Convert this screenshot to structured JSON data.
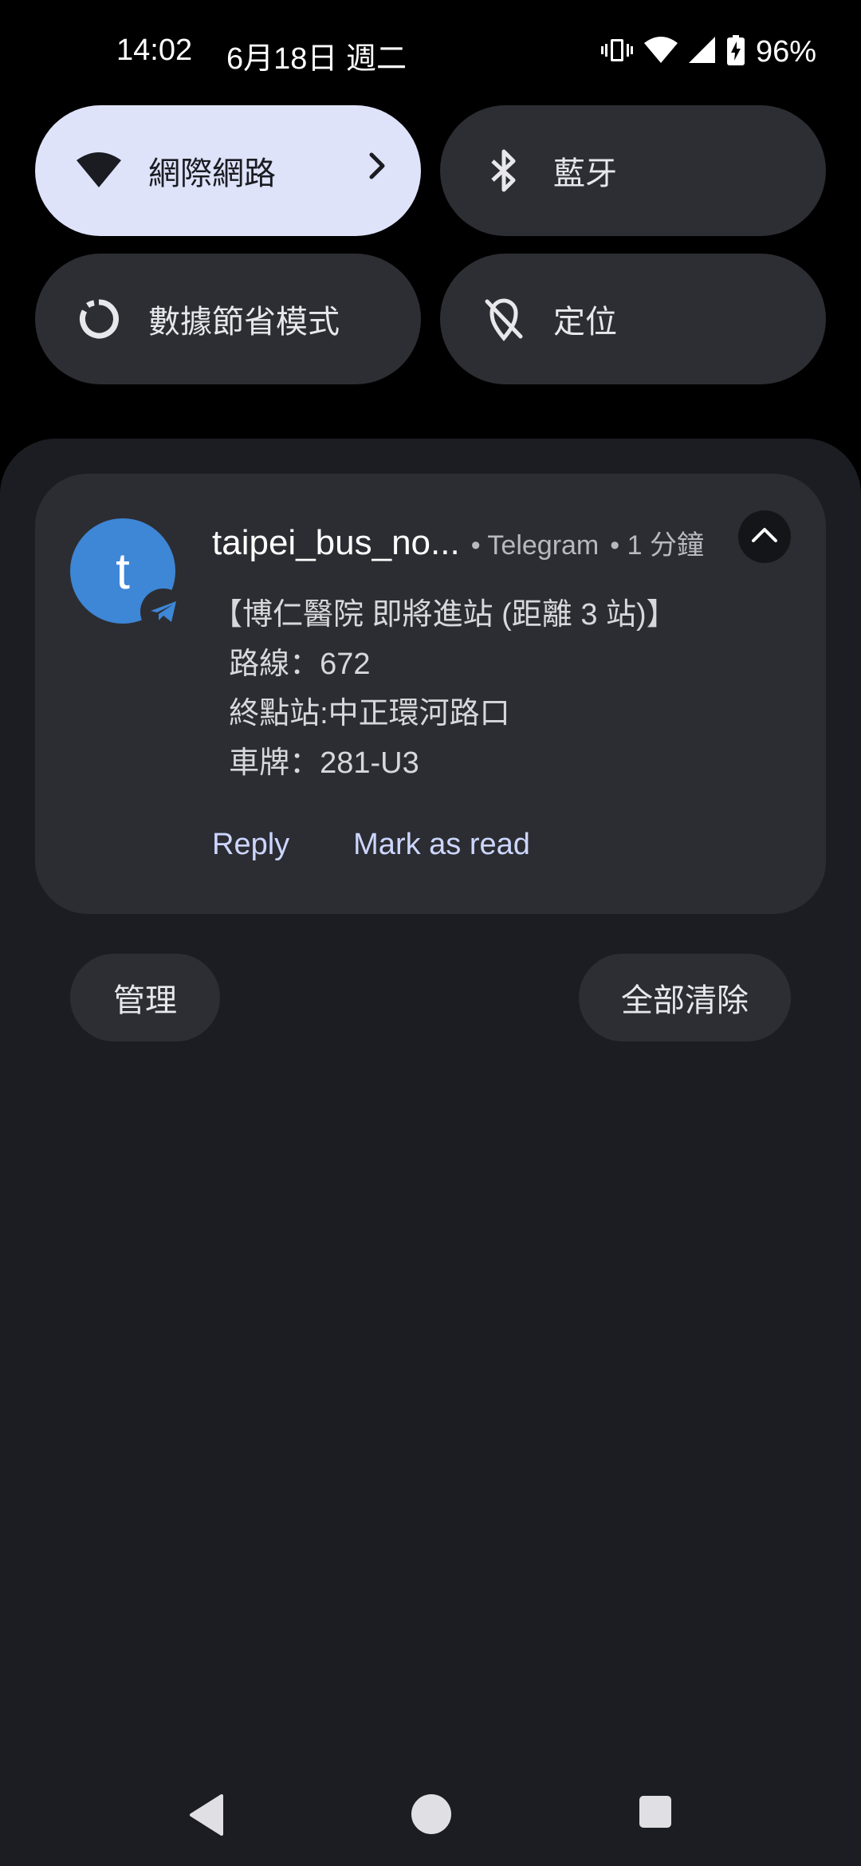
{
  "status_bar": {
    "time": "14:02",
    "date": "6月18日 週二",
    "battery": "96%",
    "icons": [
      "vibrate-icon",
      "wifi-icon",
      "cellular-signal-icon",
      "battery-charging-icon"
    ]
  },
  "quick_tiles": [
    {
      "label": "網際網路",
      "icon": "wifi-icon",
      "active": true
    },
    {
      "label": "藍牙",
      "icon": "bluetooth-icon",
      "active": false
    },
    {
      "label": "數據節省模式",
      "icon": "data-saver-icon",
      "active": false
    },
    {
      "label": "定位",
      "icon": "location-off-icon",
      "active": false
    }
  ],
  "notification": {
    "avatar_letter": "t",
    "app_icon": "telegram-icon",
    "title": "taipei_bus_no...",
    "app": "• Telegram",
    "time": "• 1 分鐘",
    "lines": [
      "【博仁醫院 即將進站 (距離 3 站)】",
      "  路線：672",
      "  終點站:中正環河路口",
      "  車牌：281-U3"
    ],
    "actions": [
      "Reply",
      "Mark as read"
    ]
  },
  "footer": {
    "manage": "管理",
    "clear_all": "全部清除"
  },
  "colors": {
    "accent_tile": "#dfe3fa",
    "avatar": "#3e86d6",
    "action_text": "#cdd6ff"
  }
}
